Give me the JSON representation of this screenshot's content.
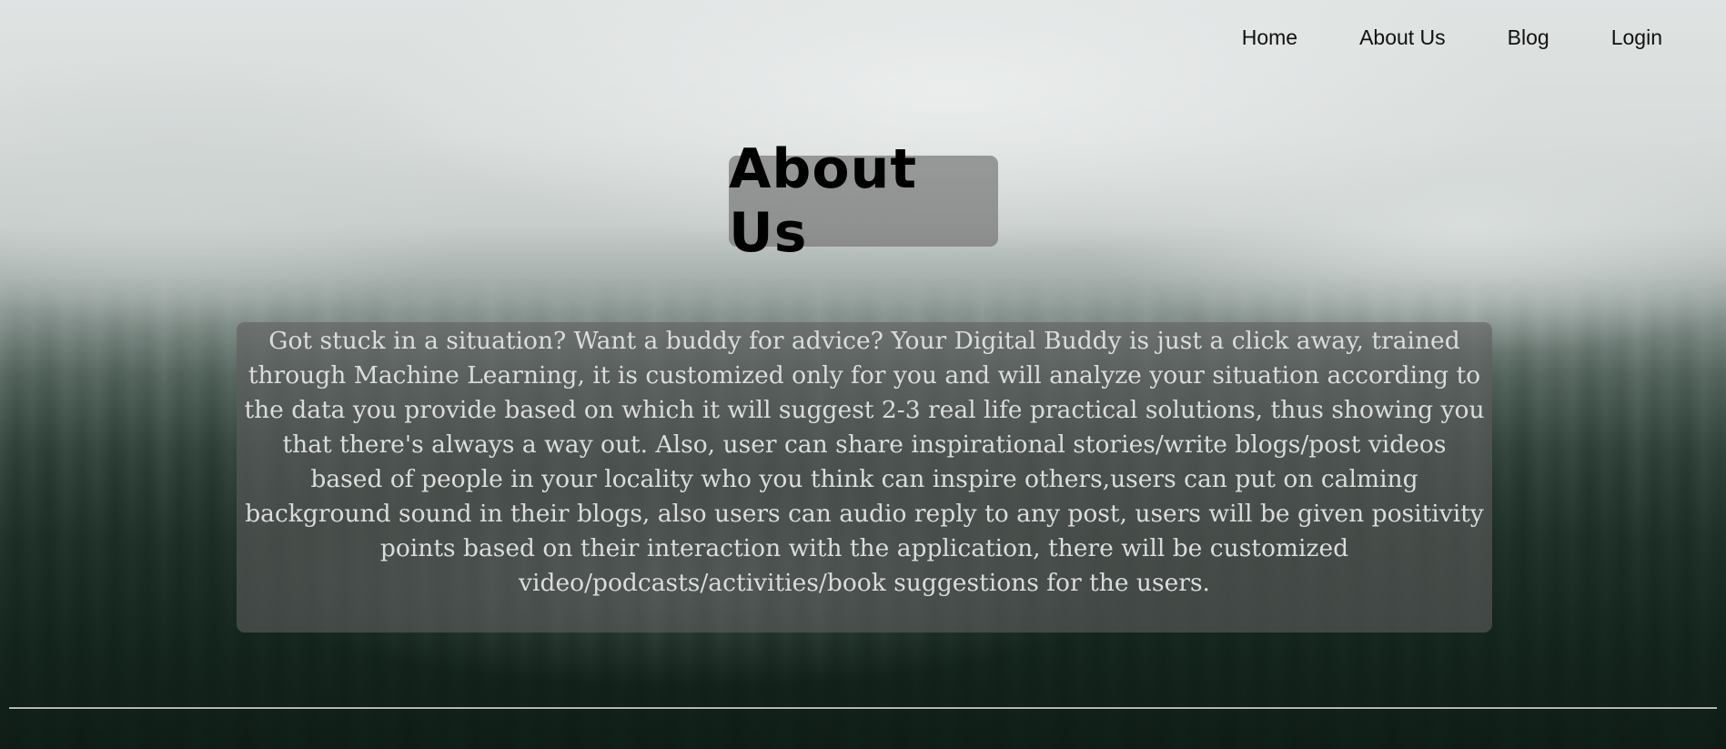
{
  "nav": {
    "items": [
      {
        "label": "Home"
      },
      {
        "label": "About Us"
      },
      {
        "label": "Blog"
      },
      {
        "label": "Login"
      }
    ]
  },
  "hero": {
    "title": "About Us"
  },
  "about": {
    "description": "Got stuck in a situation? Want a buddy for advice? Your Digital Buddy is just a click away, trained through Machine Learning, it is customized only for you and will analyze your situation according to the data you provide based on which it will suggest 2-3 real life practical solutions, thus showing you that there's always a way out. Also, user can share inspirational stories/write blogs/post videos based of people in your locality who you think can inspire others,users can put on calming background sound in their blogs, also users can audio reply to any post, users will be given positivity points based on their interaction with the application, there will be customized video/podcasts/activities/book suggestions for the users."
  },
  "colors": {
    "title_box_bg": "#6e6e6e",
    "desc_text": "#dcdcdc",
    "nav_text": "#111111"
  }
}
